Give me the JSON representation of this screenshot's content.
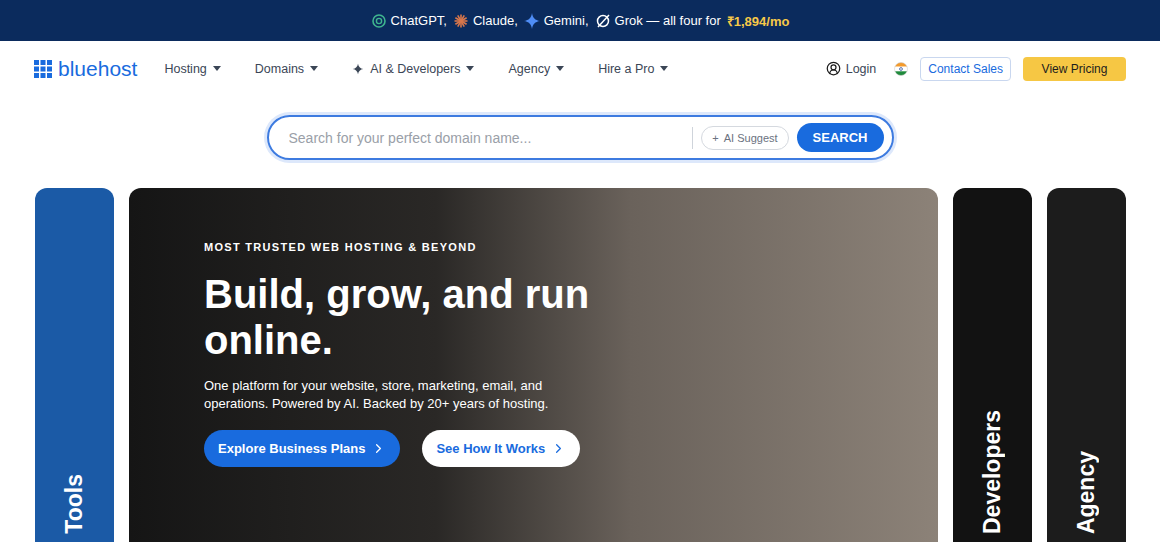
{
  "banner": {
    "items": [
      {
        "label": "ChatGPT,",
        "kind": "chatgpt"
      },
      {
        "label": "Claude,",
        "kind": "claude"
      },
      {
        "label": "Gemini,",
        "kind": "gemini"
      },
      {
        "label": "Grok — all four for",
        "kind": "grok"
      }
    ],
    "price": "₹1,894/mo"
  },
  "nav": {
    "logo": "bluehost",
    "items": [
      {
        "label": "Hosting",
        "sparkle": false
      },
      {
        "label": "Domains",
        "sparkle": false
      },
      {
        "label": "AI & Developers",
        "sparkle": true
      },
      {
        "label": "Agency",
        "sparkle": false
      },
      {
        "label": "Hire a Pro",
        "sparkle": false
      }
    ],
    "login": "Login",
    "contact": "Contact Sales",
    "pricing": "View Pricing"
  },
  "search": {
    "placeholder": "Search for your perfect domain name...",
    "ai_icon": "+",
    "ai_button": "AI Suggest",
    "button": "SEARCH"
  },
  "carousel": [
    {
      "kind": "side",
      "label": "Tools",
      "color": "#1b5aa6"
    },
    {
      "kind": "hero",
      "eyebrow": "MOST TRUSTED WEB HOSTING & BEYOND",
      "title": "Build, grow, and run online.",
      "description": "One platform for your website, store, marketing, email, and operations. Powered by AI. Backed by 20+ years of hosting.",
      "buttons": [
        {
          "label": "Explore Business Plans",
          "primary": true
        },
        {
          "label": "See How It Works",
          "primary": false
        }
      ],
      "color": "#151515"
    },
    {
      "kind": "side",
      "label": "Developers",
      "color": "#121212"
    },
    {
      "kind": "side",
      "label": "Agency",
      "color": "#1c1c1c"
    }
  ]
}
